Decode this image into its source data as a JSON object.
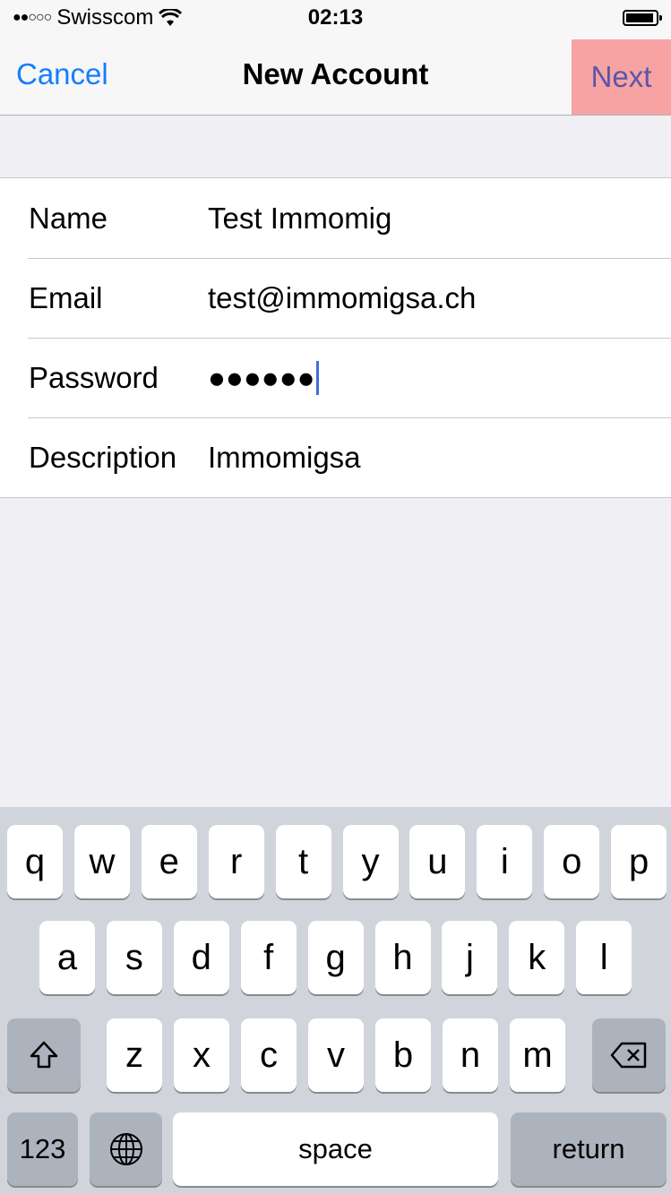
{
  "status_bar": {
    "signal": "●●○○○",
    "carrier": "Swisscom",
    "time": "02:13"
  },
  "nav": {
    "cancel_label": "Cancel",
    "title": "New Account",
    "next_label": "Next"
  },
  "form": {
    "rows": [
      {
        "label": "Name",
        "value": "Test Immomig"
      },
      {
        "label": "Email",
        "value": "test@immomigsa.ch"
      },
      {
        "label": "Password",
        "value": "●●●●●●"
      },
      {
        "label": "Description",
        "value": "Immomigsa"
      }
    ]
  },
  "keyboard": {
    "row1": [
      "q",
      "w",
      "e",
      "r",
      "t",
      "y",
      "u",
      "i",
      "o",
      "p"
    ],
    "row2": [
      "a",
      "s",
      "d",
      "f",
      "g",
      "h",
      "j",
      "k",
      "l"
    ],
    "row3": [
      "z",
      "x",
      "c",
      "v",
      "b",
      "n",
      "m"
    ],
    "shift_icon": "shift-icon",
    "delete_icon": "delete-icon",
    "numbers_label": "123",
    "globe_icon": "globe-icon",
    "space_label": "space",
    "return_label": "return"
  },
  "colors": {
    "accent": "#157efb",
    "next_highlight": "#f7a2a3",
    "next_text": "#5a56a8",
    "caret": "#3e6fdc"
  }
}
